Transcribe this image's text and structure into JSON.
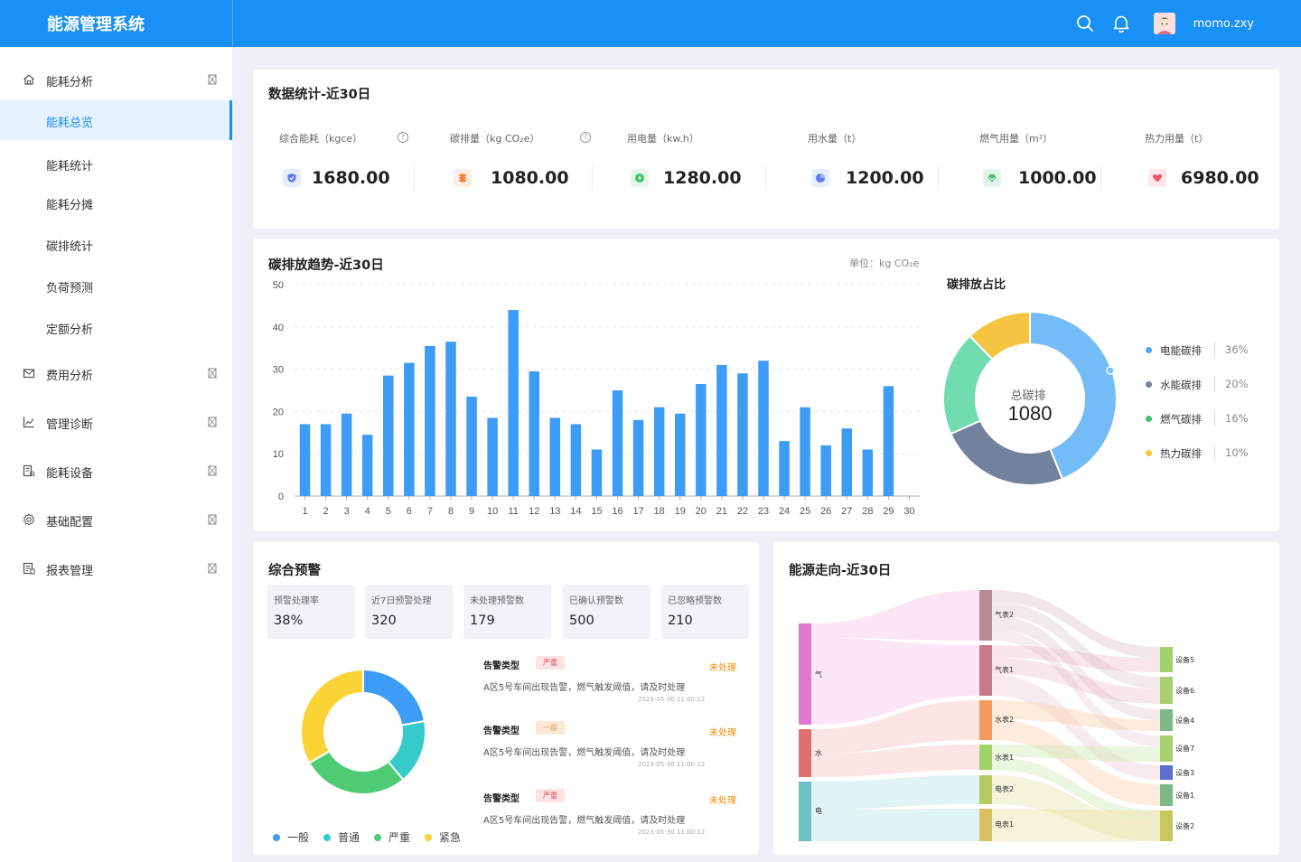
{
  "app": {
    "title": "能源管理系统",
    "username": "momo.zxy"
  },
  "sidebar": {
    "groups": [
      {
        "label": "能耗分析",
        "icon": "home-icon"
      },
      {
        "label": "费用分析",
        "icon": "mail-icon"
      },
      {
        "label": "管理诊断",
        "icon": "chart-icon"
      },
      {
        "label": "能耗设备",
        "icon": "device-icon"
      },
      {
        "label": "基础配置",
        "icon": "gear-icon"
      },
      {
        "label": "报表管理",
        "icon": "report-icon"
      }
    ],
    "sub_items": [
      "能耗总览",
      "能耗统计",
      "能耗分摊",
      "碳排统计",
      "负荷预测",
      "定额分析"
    ],
    "active_sub": "能耗总览"
  },
  "stats": {
    "title": "数据统计-近30日",
    "items": [
      {
        "label": "综合能耗（kgce）",
        "value": "1680.00",
        "help": "?",
        "color": "#5b7bf0",
        "bg": "#e8edfd"
      },
      {
        "label": "碳排量（kg CO₂e）",
        "value": "1080.00",
        "help": "?",
        "color": "#f5803e",
        "bg": "#feeee3"
      },
      {
        "label": "用电量（kw.h）",
        "value": "1280.00",
        "color": "#3fbf70",
        "bg": "#e2f6ea"
      },
      {
        "label": "用水量（t）",
        "value": "1200.00",
        "color": "#5b7bf0",
        "bg": "#e8edfd"
      },
      {
        "label": "燃气用量（m²）",
        "value": "1000.00",
        "color": "#3fbf70",
        "bg": "#e2f6ea"
      },
      {
        "label": "热力用量（t）",
        "value": "6980.00",
        "color": "#f0566a",
        "bg": "#fde7ea"
      }
    ]
  },
  "trend": {
    "title": "碳排放趋势-近30日",
    "unit": "单位：kg CO₂e"
  },
  "carbon_share": {
    "title": "碳排放占比",
    "center_label": "总碳排",
    "center_value": "1080",
    "legend": [
      {
        "name": "电能碳排",
        "pct": "36%",
        "color": "#4da3f7"
      },
      {
        "name": "水能碳排",
        "pct": "20%",
        "color": "#73819c"
      },
      {
        "name": "燃气碳排",
        "pct": "16%",
        "color": "#3dc26b"
      },
      {
        "name": "热力碳排",
        "pct": "10%",
        "color": "#f5c33b"
      }
    ]
  },
  "warning": {
    "title": "综合预警",
    "kpis": [
      {
        "label": "预警处理率",
        "value": "38%"
      },
      {
        "label": "近7日预警处理",
        "value": "320"
      },
      {
        "label": "未处理预警数",
        "value": "179"
      },
      {
        "label": "已确认预警数",
        "value": "500"
      },
      {
        "label": "已忽略预警数",
        "value": "210"
      }
    ],
    "alerts": [
      {
        "type": "告警类型",
        "level": "严重",
        "status": "未处理",
        "desc": "A区5号车间出现告警，燃气触发阈值，请及时处理",
        "time": "2023-05-30 11:00:12",
        "level_bg": "#fde2e4",
        "level_color": "#e05060"
      },
      {
        "type": "告警类型",
        "level": "一般",
        "status": "未处理",
        "desc": "A区5号车间出现告警，燃气触发阈值，请及时处理",
        "time": "2023-05-30 11:00:12",
        "level_bg": "#fbe9d6",
        "level_color": "#d89a5c"
      },
      {
        "type": "告警类型",
        "level": "严重",
        "status": "未处理",
        "desc": "A区5号车间出现告警，燃气触发阈值，请及时处理",
        "time": "2023-05-30 11:00:12",
        "level_bg": "#fde2e4",
        "level_color": "#e05060"
      }
    ],
    "pie_legend": [
      {
        "name": "一般",
        "color": "#3d9cf5"
      },
      {
        "name": "普通",
        "color": "#36cbcb"
      },
      {
        "name": "严重",
        "color": "#4ecb73"
      },
      {
        "name": "紧急",
        "color": "#fad337"
      }
    ]
  },
  "flow": {
    "title": "能源走向-近30日",
    "sources": [
      {
        "name": "气",
        "color": "#e07ad0"
      },
      {
        "name": "水",
        "color": "#e07070"
      },
      {
        "name": "电",
        "color": "#6cc0c8"
      }
    ],
    "meters": [
      {
        "name": "气表2",
        "color": "#b88a94"
      },
      {
        "name": "气表1",
        "color": "#c87a8a"
      },
      {
        "name": "水表2",
        "color": "#f59a5a"
      },
      {
        "name": "水表1",
        "color": "#9ed36a"
      },
      {
        "name": "电表2",
        "color": "#b8c864"
      },
      {
        "name": "电表1",
        "color": "#d8c060"
      }
    ],
    "devices": [
      {
        "name": "设备5",
        "color": "#9ed36a"
      },
      {
        "name": "设备6",
        "color": "#a8d070"
      },
      {
        "name": "设备4",
        "color": "#7db88a"
      },
      {
        "name": "设备7",
        "color": "#a8d070"
      },
      {
        "name": "设备3",
        "color": "#5a6fd0"
      },
      {
        "name": "设备1",
        "color": "#7db88a"
      },
      {
        "name": "设备2",
        "color": "#c8c860"
      }
    ]
  },
  "chart_data": [
    {
      "type": "bar",
      "title": "碳排放趋势-近30日",
      "ylabel": "",
      "xlabel": "",
      "categories": [
        "1",
        "2",
        "3",
        "4",
        "5",
        "6",
        "7",
        "8",
        "9",
        "10",
        "11",
        "12",
        "13",
        "14",
        "15",
        "16",
        "17",
        "18",
        "19",
        "20",
        "21",
        "22",
        "23",
        "24",
        "25",
        "26",
        "27",
        "28",
        "29",
        "30"
      ],
      "values": [
        17,
        17,
        19.5,
        14.5,
        28.5,
        31.5,
        35.5,
        36.5,
        23.5,
        18.5,
        44,
        29.5,
        18.5,
        17,
        11,
        25,
        18,
        21,
        19.5,
        26.5,
        31,
        29,
        32,
        13,
        21,
        12,
        16,
        11,
        26
      ],
      "ylim": [
        0,
        50
      ],
      "yticks": [
        0,
        10,
        20,
        30,
        40,
        50
      ],
      "color": "#3d9cf5",
      "grid": true
    },
    {
      "type": "pie",
      "title": "碳排放占比",
      "labels": [
        "电能碳排",
        "水能碳排",
        "燃气碳排",
        "热力碳排"
      ],
      "values": [
        36,
        20,
        16,
        10
      ],
      "colors": [
        "#74bcf7",
        "#73819c",
        "#70dcb0",
        "#f5c542"
      ],
      "center_label": "总碳排",
      "center_value": "1080"
    },
    {
      "type": "pie",
      "title": "综合预警",
      "labels": [
        "一般",
        "普通",
        "严重",
        "紧急"
      ],
      "values": [
        20,
        15,
        25,
        30
      ],
      "colors": [
        "#3d9cf5",
        "#36cbcb",
        "#4ecb73",
        "#fad337"
      ]
    }
  ]
}
